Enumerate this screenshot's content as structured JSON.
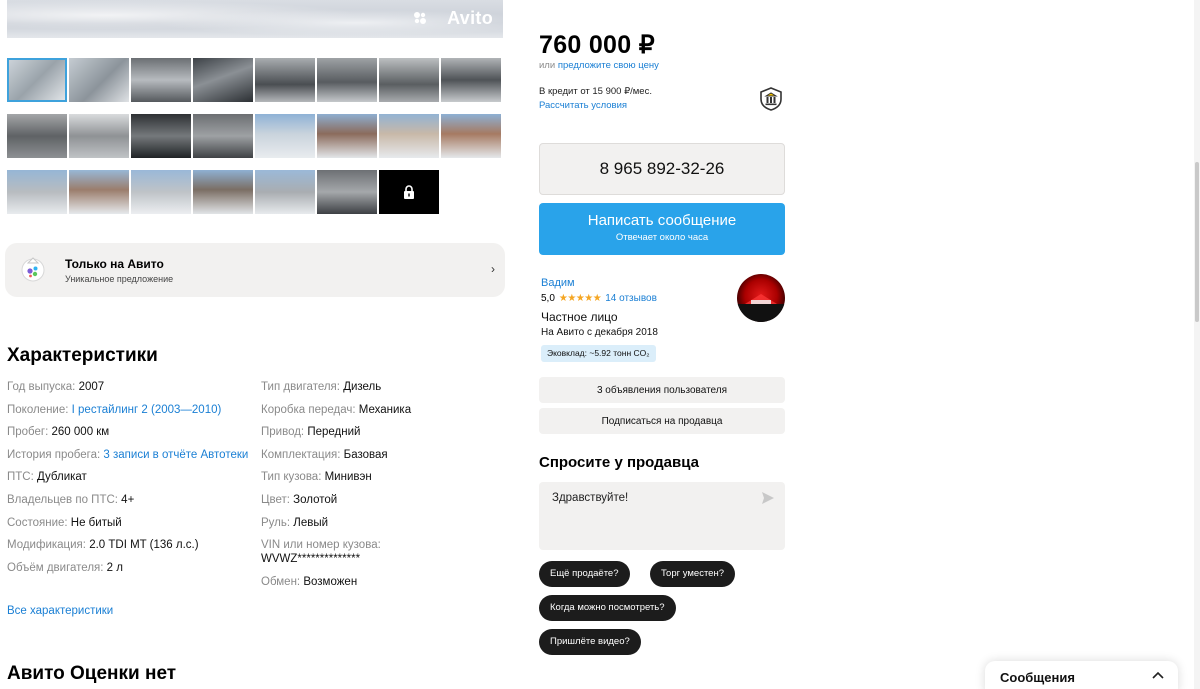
{
  "gallery": {
    "watermark": "Avito",
    "rows": [
      [
        {
          "bg": "linear-gradient(135deg,#cfd6dc,#9aa3aa 50%,#e6e9ec)"
        },
        {
          "bg": "linear-gradient(135deg,#c5ccd2,#8c949b 55%,#dfe2e5)"
        },
        {
          "bg": "linear-gradient(180deg,#6b6f73,#b7bbbf 50%,#55595d)"
        },
        {
          "bg": "linear-gradient(160deg,#3d4247,#8b9095 45%,#2c3034)"
        },
        {
          "bg": "linear-gradient(180deg,#a9adb0,#4a4e52 60%,#b4b7ba)"
        },
        {
          "bg": "linear-gradient(180deg,#9ea2a5,#585c60 55%,#c5c8cb)"
        },
        {
          "bg": "linear-gradient(180deg,#bcbfc1,#5a5e61 60%,#a8abae)"
        },
        {
          "bg": "linear-gradient(180deg,#b1b4b7,#4f5357 50%,#c7cacd)"
        }
      ],
      [
        {
          "bg": "linear-gradient(180deg,#a4a6a8,#5f6265 50%,#8d9093)"
        },
        {
          "bg": "linear-gradient(180deg,#d9dbdd,#8f9295 50%,#c0c3c6)"
        },
        {
          "bg": "linear-gradient(180deg,#2e3134,#75797c 50%,#1f2225)"
        },
        {
          "bg": "linear-gradient(180deg,#6c6f72,#9ea1a4 50%,#3f4245)"
        },
        {
          "bg": "linear-gradient(180deg,#8fb2d6,#c9d3dc 45%,#e9ecef)"
        },
        {
          "bg": "linear-gradient(180deg,#8eaed0,#8b6b5c 45%,#e3e6e9)"
        },
        {
          "bg": "linear-gradient(180deg,#93b3d3,#c8b8a8 45%,#e7eaed)"
        },
        {
          "bg": "linear-gradient(180deg,#8db0d4,#a67a62 45%,#e5e8eb)"
        }
      ],
      [
        {
          "bg": "linear-gradient(180deg,#96b6d6,#b8bcc0 50%,#e8ebee)"
        },
        {
          "bg": "linear-gradient(180deg,#98b7d6,#9b7d6c 45%,#e6e9ec)"
        },
        {
          "bg": "linear-gradient(180deg,#9ab8d8,#bfc3c7 50%,#eceef1)"
        },
        {
          "bg": "linear-gradient(180deg,#8fb0d2,#7b6e64 45%,#e1e4e7)"
        },
        {
          "bg": "linear-gradient(180deg,#9bb9d8,#a9adb1 50%,#e7eaed)"
        },
        {
          "bg": "linear-gradient(180deg,#6d7074,#a5a8ab 50%,#3d4044)"
        }
      ]
    ]
  },
  "only_avito": {
    "title": "Только на Авито",
    "subtitle": "Уникальное предложение",
    "chevron": "›"
  },
  "characteristics": {
    "heading": "Характеристики",
    "left": [
      {
        "label": "Год выпуска:",
        "value": "2007"
      },
      {
        "label": "Поколение:",
        "value": "I рестайлинг 2 (2003—2010)",
        "link": true
      },
      {
        "label": "Пробег:",
        "value": "260 000 км"
      },
      {
        "label": "История пробега:",
        "value": "3 записи в отчёте Автотеки",
        "link": true
      },
      {
        "label": "ПТС:",
        "value": "Дубликат"
      },
      {
        "label": "Владельцев по ПТС:",
        "value": "4+"
      },
      {
        "label": "Состояние:",
        "value": "Не битый"
      },
      {
        "label": "Модификация:",
        "value": "2.0 TDI MT (136 л.с.)"
      },
      {
        "label": "Объём двигателя:",
        "value": "2 л"
      }
    ],
    "right": [
      {
        "label": "Тип двигателя:",
        "value": "Дизель"
      },
      {
        "label": "Коробка передач:",
        "value": "Механика"
      },
      {
        "label": "Привод:",
        "value": "Передний"
      },
      {
        "label": "Комплектация:",
        "value": "Базовая"
      },
      {
        "label": "Тип кузова:",
        "value": "Минивэн"
      },
      {
        "label": "Цвет:",
        "value": "Золотой"
      },
      {
        "label": "Руль:",
        "value": "Левый"
      },
      {
        "label": "VIN или номер кузова:",
        "value": "WVWZ**************",
        "block": true
      },
      {
        "label": "Обмен:",
        "value": "Возможен"
      }
    ],
    "all_link": "Все характеристики"
  },
  "ocenki_heading": "Авито Оценки нет",
  "sidebar": {
    "price": "760 000 ₽",
    "offer_prefix": "или",
    "offer_link": "предложите свою цену",
    "credit": "В кредит от 15 900 ₽/мес.",
    "credit_link": "Рассчитать условия",
    "phone": "8 965 892-32-26",
    "message_btn": "Написать сообщение",
    "message_sub": "Отвечает около часа",
    "seller": {
      "name": "Вадим",
      "rating": "5,0",
      "stars": "★★★★★",
      "reviews": "14 отзывов",
      "type": "Частное лицо",
      "since": "На Авито с декабря 2018",
      "eco": "Эковклад: ~5.92 тонн CO₂"
    },
    "ads_btn": "3 объявления пользователя",
    "subscribe_btn": "Подписаться на продавца",
    "ask_heading": "Спросите у продавца",
    "ask_text": "Здравствуйте!",
    "chips": [
      "Ещё продаёте?",
      "Торг уместен?",
      "Когда можно посмотреть?",
      "Пришлёте видео?"
    ]
  },
  "messages_widget": {
    "label": "Сообщения"
  },
  "colors": {
    "accent_blue": "#29a3ea",
    "link_blue": "#1a7fd4",
    "card_grey": "#f2f1f0",
    "chip_dark": "#1c1c1c",
    "star": "#f5a623"
  }
}
